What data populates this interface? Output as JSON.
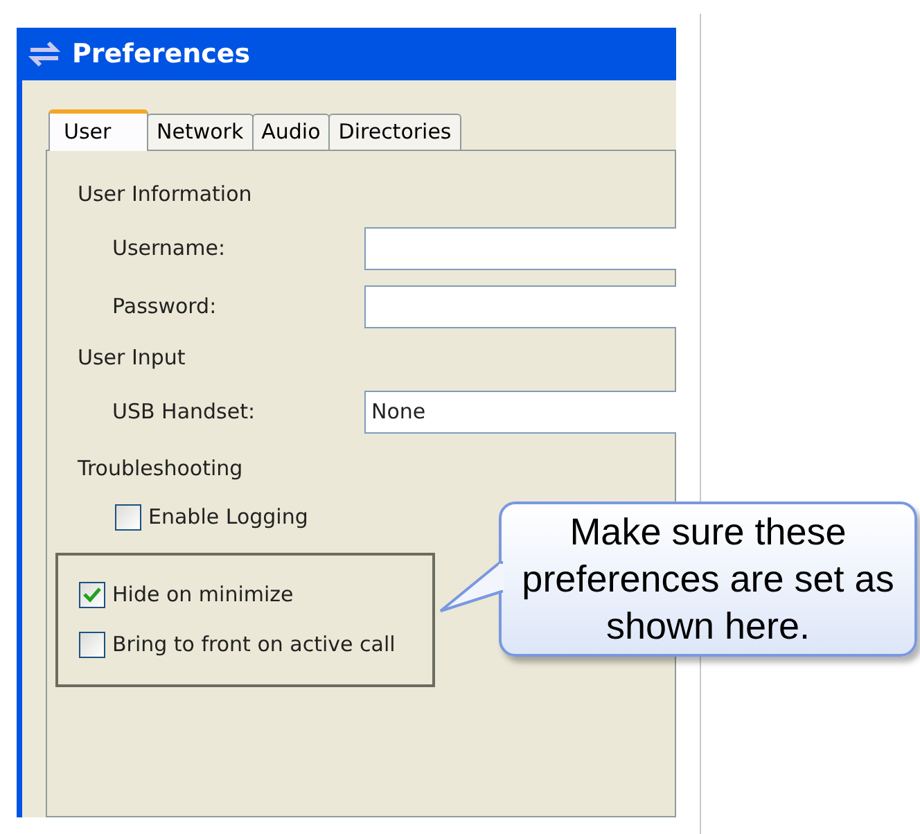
{
  "window": {
    "title": "Preferences"
  },
  "tabs": [
    {
      "label": "User",
      "selected": true
    },
    {
      "label": "Network",
      "selected": false
    },
    {
      "label": "Audio",
      "selected": false
    },
    {
      "label": "Directories",
      "selected": false
    }
  ],
  "sections": [
    {
      "heading": "User Information",
      "rows": [
        {
          "kind": "field",
          "label": "Username:"
        },
        {
          "kind": "field",
          "label": "Password:"
        }
      ]
    },
    {
      "heading": "User Input",
      "rows": [
        {
          "kind": "dropdown",
          "label": "USB Handset:",
          "value": "None"
        }
      ]
    },
    {
      "heading": "Troubleshooting",
      "rows": [
        {
          "kind": "checkbox",
          "label": "Enable Logging",
          "checked": false
        }
      ]
    }
  ],
  "highlighted_options": [
    {
      "label": "Hide on minimize",
      "checked": true
    },
    {
      "label": "Bring to front on active call",
      "checked": false
    }
  ],
  "callout": {
    "text": "Make sure these preferences are set as shown here."
  }
}
